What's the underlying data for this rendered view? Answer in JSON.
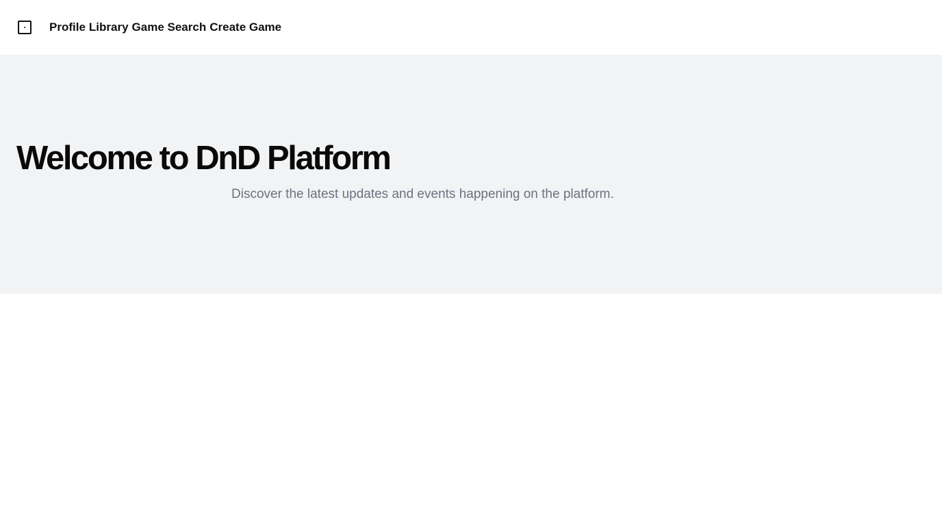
{
  "nav": {
    "logo_icon": "dice-icon",
    "links": [
      {
        "label": "Profile"
      },
      {
        "label": "Library"
      },
      {
        "label": "Game Search"
      },
      {
        "label": "Create Game"
      }
    ]
  },
  "hero": {
    "title": "Welcome to DnD Platform",
    "subtitle": "Discover the latest updates and events happening on the platform."
  },
  "colors": {
    "hero_background": "#f2f3f4",
    "text_primary": "#0a0a0a",
    "text_muted": "#6b7280"
  }
}
